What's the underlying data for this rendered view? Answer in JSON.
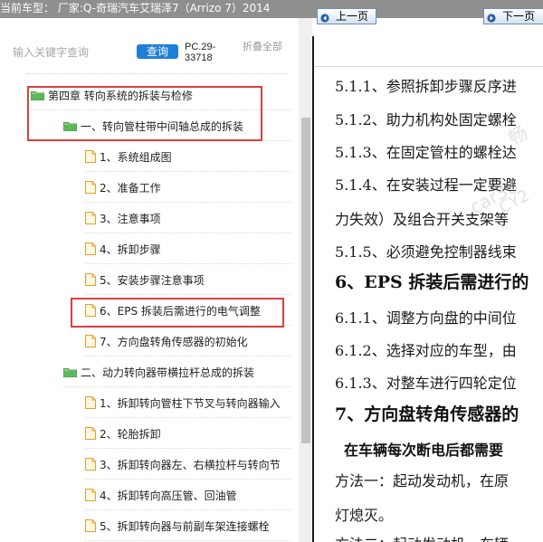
{
  "header": {
    "title": "当前车型：  厂家:Q-奇瑞汽车艾瑞泽7（Arrizo 7）2014"
  },
  "toolbar": {
    "search_placeholder": "输入关键字查询",
    "search_button": "查询",
    "pc_code": "PC.29-33718",
    "collapse_all": "折叠全部"
  },
  "tree": [
    {
      "label": "第四章 转向系统的拆装与检修",
      "type": "folder",
      "level": 0
    },
    {
      "label": "一、转向管柱带中间轴总成的拆装",
      "type": "folder",
      "level": 1
    },
    {
      "label": "1、系统组成图",
      "type": "file",
      "level": 2
    },
    {
      "label": "2、准备工作",
      "type": "file",
      "level": 2
    },
    {
      "label": "3、注意事项",
      "type": "file",
      "level": 2
    },
    {
      "label": "4、拆卸步骤",
      "type": "file",
      "level": 2
    },
    {
      "label": "5、安装步骤注意事项",
      "type": "file",
      "level": 2
    },
    {
      "label": "6、EPS 拆装后需进行的电气调整",
      "type": "file",
      "level": 2
    },
    {
      "label": "7、方向盘转角传感器的初始化",
      "type": "file",
      "level": 2
    },
    {
      "label": "二、动力转向器带横拉杆总成的拆装",
      "type": "folder",
      "level": 1
    },
    {
      "label": "1、拆卸转向管柱下节叉与转向器输入",
      "type": "file",
      "level": 2
    },
    {
      "label": "2、轮胎拆卸",
      "type": "file",
      "level": 2
    },
    {
      "label": "3、拆卸转向器左、右横拉杆与转向节",
      "type": "file",
      "level": 2
    },
    {
      "label": "4、拆卸转向高压管、回油管",
      "type": "file",
      "level": 2
    },
    {
      "label": "5、拆卸转向器与前副车架连接螺栓",
      "type": "file",
      "level": 2
    }
  ],
  "colors": {
    "accent": "#1e7fd8",
    "folder": "#5cb85c",
    "file": "#f0b44a",
    "highlight": "#d9413f"
  },
  "viewer": {
    "prev_label": "上一页",
    "next_label": "下一页",
    "lines": [
      "5.1.1、参照拆卸步骤反序进",
      "5.1.2、助力机构处固定螺栓",
      "5.1.3、在固定管柱的螺栓达",
      "5.1.4、在安装过程一定要避",
      "力失效）及组合开关支架等",
      "5.1.5、必须避免控制器线束",
      "6、EPS 拆装后需进行的",
      "6.1.1、调整方向盘的中间位",
      "6.1.2、选择对应的车型，由",
      "6.1.3、对整车进行四轮定位",
      "7、方向盘转角传感器的",
      "在车辆每次断电后都需要",
      "方法一：起动发动机，在原",
      "灯熄灭。",
      "方法二：起动发动机，车辆"
    ],
    "watermarks": [
      "畅",
      "car38",
      "CY2"
    ]
  }
}
